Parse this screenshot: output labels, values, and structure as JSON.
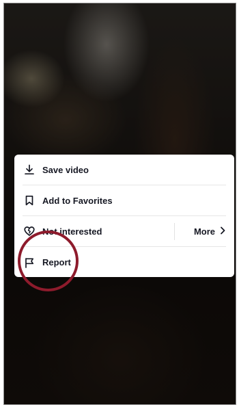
{
  "menu": {
    "items": [
      {
        "label": "Save video",
        "icon": "download-icon"
      },
      {
        "label": "Add to Favorites",
        "icon": "bookmark-icon"
      },
      {
        "label": "Not interested",
        "icon": "broken-heart-icon"
      },
      {
        "label": "Report",
        "icon": "flag-icon"
      }
    ],
    "more_label": "More"
  },
  "colors": {
    "text": "#161823",
    "annotation": "#8e1b2c",
    "menu_bg": "#ffffff"
  }
}
